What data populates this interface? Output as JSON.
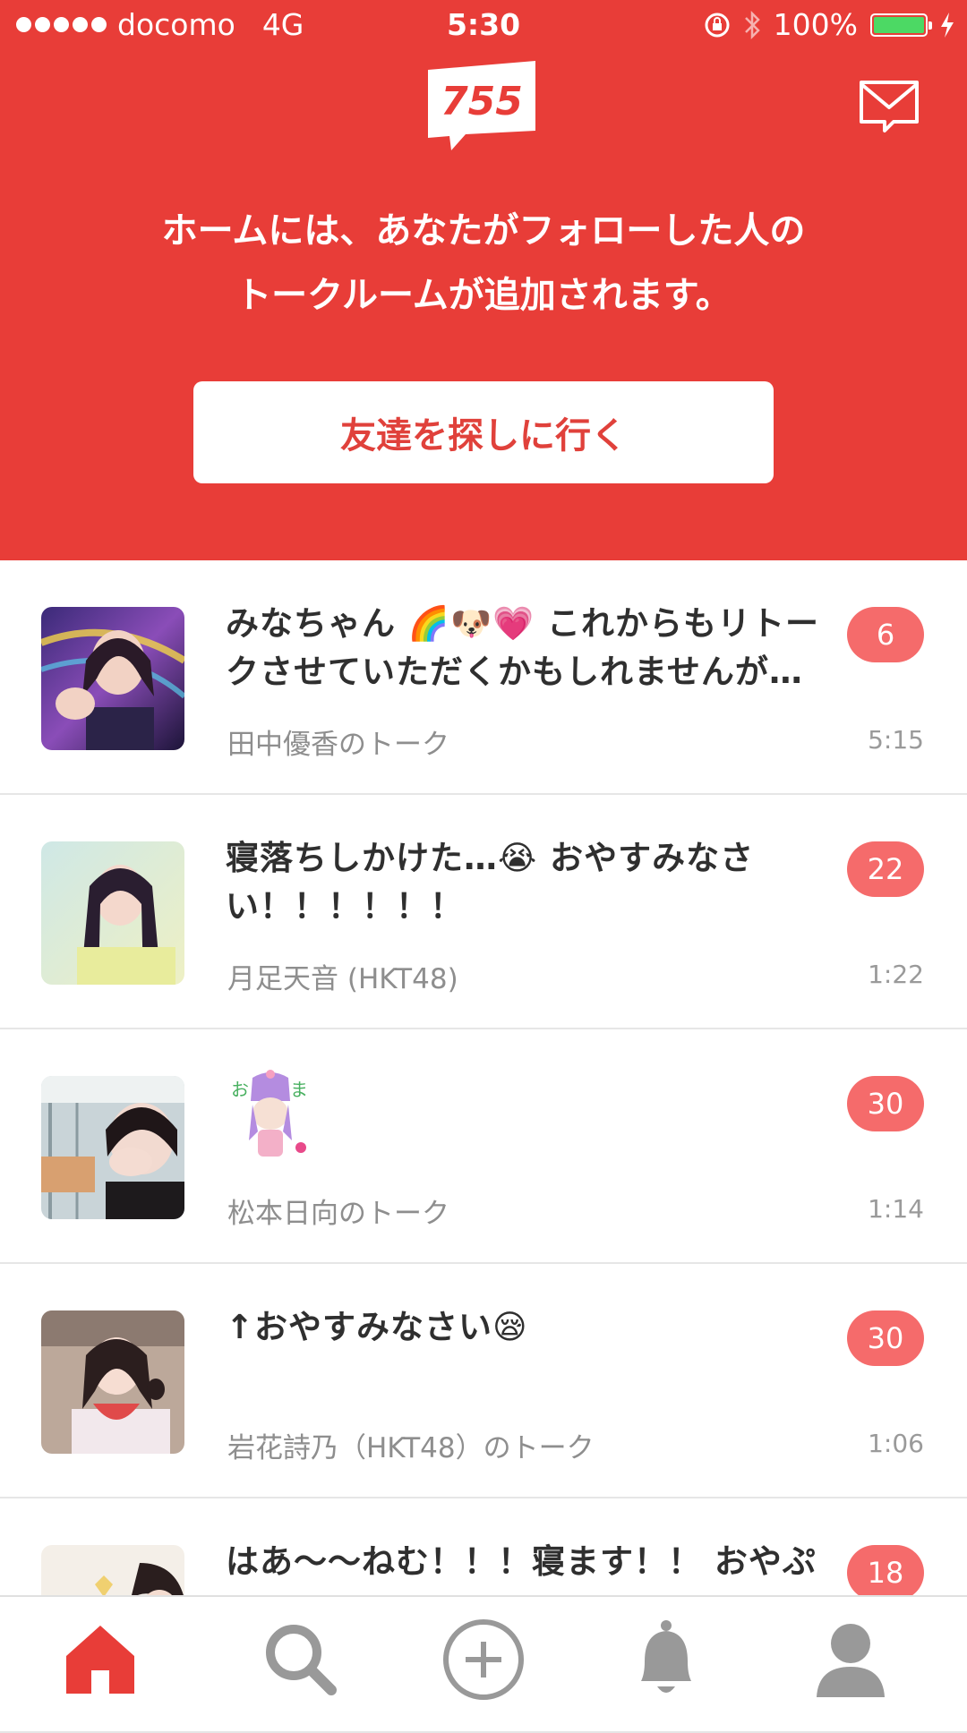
{
  "status_bar": {
    "carrier": "docomo",
    "network": "4G",
    "time": "5:30",
    "battery": "100%",
    "battery_level": 1.0
  },
  "header": {
    "logo_text": "755",
    "intro_line1": "ホームには、あなたがフォローした人の",
    "intro_line2": "トークルームが追加されます。",
    "find_friends_label": "友達を探しに行く"
  },
  "colors": {
    "brand_red": "#e83d38",
    "badge_red": "#f56b6b",
    "button_text_red": "#e0413b"
  },
  "talks": [
    {
      "message": "みなちゃん 🌈🐶💗 これからもリトークさせていただくかもしれませんが…",
      "room": "田中優香のトーク",
      "time": "5:15",
      "unread": "6"
    },
    {
      "message": "寝落ちしかけた…😭 おやすみなさい！！！！！！",
      "room": "月足天音 (HKT48)",
      "time": "1:22",
      "unread": "22"
    },
    {
      "message": "",
      "sticker": "sticker-icon",
      "room": "松本日向のトーク",
      "time": "1:14",
      "unread": "30"
    },
    {
      "message": "↑おやすみなさい😪",
      "room": "岩花詩乃（HKT48）のトーク",
      "time": "1:06",
      "unread": "30"
    },
    {
      "message": "はあ〜〜ねむ！！！寝ます！！ おやぷ",
      "room": "",
      "time": "",
      "unread": "18"
    }
  ],
  "tab_bar": {
    "tabs": [
      "home-icon",
      "search-icon",
      "add-icon",
      "bell-icon",
      "profile-icon"
    ],
    "active": "home-icon"
  }
}
